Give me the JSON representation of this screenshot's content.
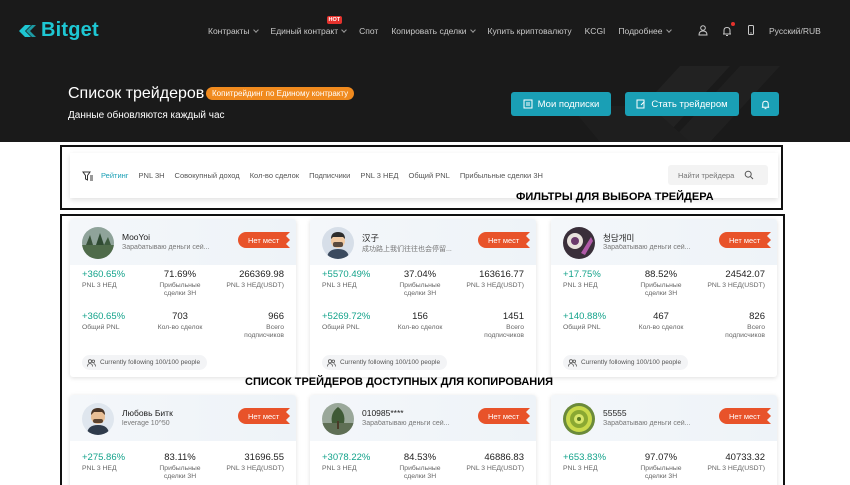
{
  "nav": {
    "logo": "Bitget",
    "items": [
      {
        "label": "Контракты",
        "chevron": true
      },
      {
        "label": "Единый контракт",
        "chevron": true,
        "badge": "HOT"
      },
      {
        "label": "Спот",
        "chevron": false
      },
      {
        "label": "Копировать сделки",
        "chevron": true
      },
      {
        "label": "Купить криптовалюту",
        "chevron": false
      },
      {
        "label": "KCGI",
        "chevron": false
      },
      {
        "label": "Подробнее",
        "chevron": true
      }
    ],
    "icons": [
      "user-icon",
      "bell-icon",
      "phone-icon"
    ],
    "language": "Русский/RUB"
  },
  "hero": {
    "title": "Список трейдеров",
    "badge": "Копитрейдинг по Единому контракту",
    "subtitle": "Данные обновляются каждый час",
    "btn_subscriptions": "Мои подписки",
    "btn_become_trader": "Стать трейдером"
  },
  "filters": {
    "tabs": [
      "Рейтинг",
      "PNL 3Н",
      "Совокупный доход",
      "Кол-во сделок",
      "Подписчики",
      "PNL 3 НЕД",
      "Общий PNL",
      "Прибыльные сделки 3Н"
    ],
    "active_tab": "Рейтинг",
    "search_placeholder": "Найти трейдера",
    "annotation": "ФИЛЬТРЫ ДЛЯ ВЫБОРА ТРЕЙДЕРА"
  },
  "grid_annotation": "СПИСОК ТРЕЙДЕРОВ ДОСТУПНЫХ ДЛЯ КОПИРОВАНИЯ",
  "labels": {
    "pnl3w": "PNL 3 НЕД",
    "profitable": "Прибыльные\nсделки 3Н",
    "pnl3w_usdt": "PNL 3 НЕД(USDT)",
    "total_pnl": "Общий PNL",
    "trades": "Кол-во сделок",
    "subscribers": "Всего\nподписчиков",
    "no_place": "Нет мест"
  },
  "traders": [
    {
      "name": "MooYoi",
      "desc": "Зарабатываю деньги сей...",
      "pnl3w": "+360.65%",
      "profitable": "71.69%",
      "pnl3w_usdt": "266369.98",
      "total_pnl": "+360.65%",
      "trades": "703",
      "subscribers": "966",
      "following": "Currently following 100/100 people"
    },
    {
      "name": "汉子",
      "desc": "成功路上我们往往也会停留...",
      "pnl3w": "+5570.49%",
      "profitable": "37.04%",
      "pnl3w_usdt": "163616.77",
      "total_pnl": "+5269.72%",
      "trades": "156",
      "subscribers": "1451",
      "following": "Currently following 100/100 people"
    },
    {
      "name": "청담개미",
      "desc": "Зарабатываю деньги сей...",
      "pnl3w": "+17.75%",
      "profitable": "88.52%",
      "pnl3w_usdt": "24542.07",
      "total_pnl": "+140.88%",
      "trades": "467",
      "subscribers": "826",
      "following": "Currently following 100/100 people"
    },
    {
      "name": "Любовь Битк",
      "desc": "leverage 10^50",
      "pnl3w": "+275.86%",
      "profitable": "83.11%",
      "pnl3w_usdt": "31696.55"
    },
    {
      "name": "010985****",
      "desc": "Зарабатываю деньги сей...",
      "pnl3w": "+3078.22%",
      "profitable": "84.53%",
      "pnl3w_usdt": "46886.83"
    },
    {
      "name": "55555",
      "desc": "Зарабатываю деньги сей...",
      "pnl3w": "+653.83%",
      "profitable": "97.07%",
      "pnl3w_usdt": "40733.32"
    }
  ],
  "colors": {
    "accent": "#1a9fb5",
    "orange": "#f08a1e",
    "green": "#14a38b",
    "nav_bg": "#1a1a1a",
    "badge_red": "#e8532a"
  }
}
